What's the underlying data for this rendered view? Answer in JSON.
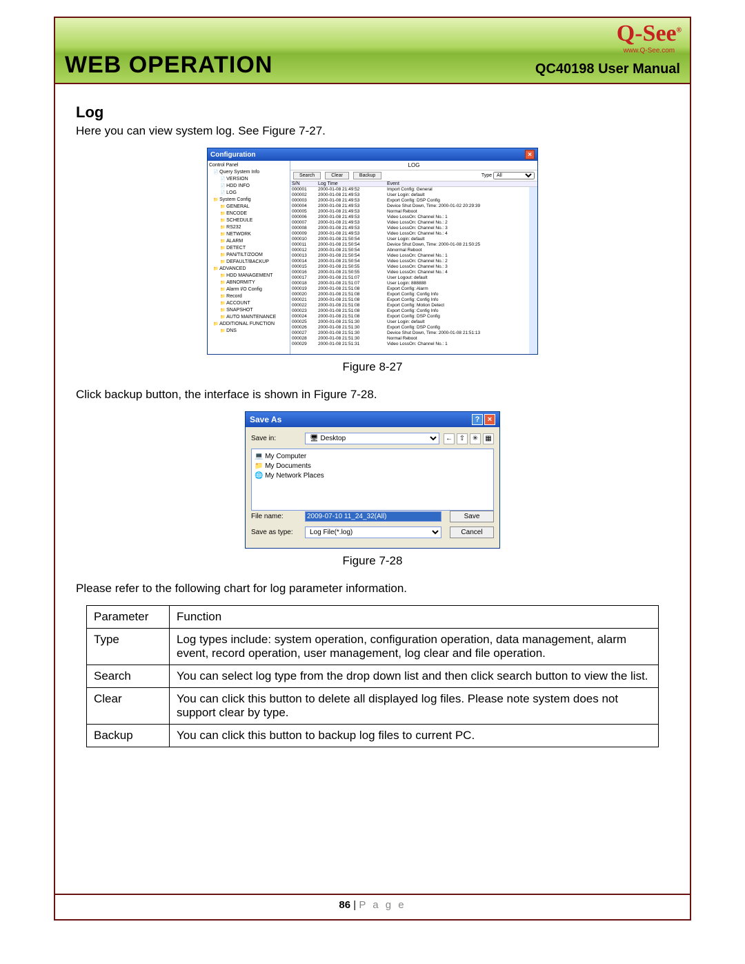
{
  "header": {
    "title": "WEB OPERATION",
    "subtitle": "QC40198 User Manual",
    "logo_text": "Q-See",
    "logo_sub": "www.Q-See.com"
  },
  "section_heading": "Log",
  "intro_text": "Here you can view system log. See Figure 7-27.",
  "fig27": {
    "window_title": "Configuration",
    "tree_header": "Control Panel",
    "tree": [
      {
        "l": 1,
        "t": "Query System Info",
        "c": "file"
      },
      {
        "l": 2,
        "t": "VERSION",
        "c": "file"
      },
      {
        "l": 2,
        "t": "HDD INFO",
        "c": "file"
      },
      {
        "l": 2,
        "t": "LOG",
        "c": "file"
      },
      {
        "l": 1,
        "t": "System Config",
        "c": "folder"
      },
      {
        "l": 2,
        "t": "GENERAL",
        "c": "folder"
      },
      {
        "l": 2,
        "t": "ENCODE",
        "c": "folder"
      },
      {
        "l": 2,
        "t": "SCHEDULE",
        "c": "folder"
      },
      {
        "l": 2,
        "t": "RS232",
        "c": "folder"
      },
      {
        "l": 2,
        "t": "NETWORK",
        "c": "folder"
      },
      {
        "l": 2,
        "t": "ALARM",
        "c": "folder"
      },
      {
        "l": 2,
        "t": "DETECT",
        "c": "folder"
      },
      {
        "l": 2,
        "t": "PAN/TILT/ZOOM",
        "c": "folder"
      },
      {
        "l": 2,
        "t": "DEFAULT/BACKUP",
        "c": "folder"
      },
      {
        "l": 1,
        "t": "ADVANCED",
        "c": "folder"
      },
      {
        "l": 2,
        "t": "HDD MANAGEMENT",
        "c": "folder"
      },
      {
        "l": 2,
        "t": "ABNORMITY",
        "c": "folder"
      },
      {
        "l": 2,
        "t": "Alarm I/O Config",
        "c": "folder"
      },
      {
        "l": 2,
        "t": "Record",
        "c": "folder"
      },
      {
        "l": 2,
        "t": "ACCOUNT",
        "c": "folder"
      },
      {
        "l": 2,
        "t": "SNAPSHOT",
        "c": "folder"
      },
      {
        "l": 2,
        "t": "AUTO MAINTENANCE",
        "c": "folder"
      },
      {
        "l": 1,
        "t": "ADDITIONAL FUNCTION",
        "c": "folder"
      },
      {
        "l": 2,
        "t": "DNS",
        "c": "folder"
      }
    ],
    "panel_label": "LOG",
    "btn_search": "Search",
    "btn_clear": "Clear",
    "btn_backup": "Backup",
    "type_label": "Type",
    "type_value": "All",
    "col_sn": "S/N",
    "col_time": "Log Time",
    "col_event": "Event",
    "rows": [
      {
        "sn": "000001",
        "t": "2000-01-08 21:49:52",
        "e": "Import Config: General"
      },
      {
        "sn": "000002",
        "t": "2000-01-08 21:49:53",
        "e": "User Login: default"
      },
      {
        "sn": "000003",
        "t": "2000-01-08 21:49:53",
        "e": "Export Config: DSP Config"
      },
      {
        "sn": "000004",
        "t": "2000-01-08 21:49:53",
        "e": "Device Shut Down, Time: 2000-01-02 20:29:39"
      },
      {
        "sn": "000005",
        "t": "2000-01-08 21:49:53",
        "e": "Normal Reboot"
      },
      {
        "sn": "000006",
        "t": "2000-01-08 21:49:53",
        "e": "Video LossOn: Channel No.: 1"
      },
      {
        "sn": "000007",
        "t": "2000-01-08 21:49:53",
        "e": "Video LossOn: Channel No.: 2"
      },
      {
        "sn": "000008",
        "t": "2000-01-08 21:49:53",
        "e": "Video LossOn: Channel No.: 3"
      },
      {
        "sn": "000009",
        "t": "2000-01-08 21:49:53",
        "e": "Video LossOn: Channel No.: 4"
      },
      {
        "sn": "000010",
        "t": "2000-01-08 21:50:54",
        "e": "User Login: default"
      },
      {
        "sn": "000011",
        "t": "2000-01-08 21:50:54",
        "e": "Device Shut Down, Time: 2000-01-08 21:50:25"
      },
      {
        "sn": "000012",
        "t": "2000-01-08 21:50:54",
        "e": "Abnormal Reboot"
      },
      {
        "sn": "000013",
        "t": "2000-01-08 21:50:54",
        "e": "Video LossOn: Channel No.: 1"
      },
      {
        "sn": "000014",
        "t": "2000-01-08 21:50:54",
        "e": "Video LossOn: Channel No.: 2"
      },
      {
        "sn": "000015",
        "t": "2000-01-08 21:50:55",
        "e": "Video LossOn: Channel No.: 3"
      },
      {
        "sn": "000016",
        "t": "2000-01-08 21:50:55",
        "e": "Video LossOn: Channel No.: 4"
      },
      {
        "sn": "000017",
        "t": "2000-01-08 21:51:07",
        "e": "User Logout: default"
      },
      {
        "sn": "000018",
        "t": "2000-01-08 21:51:07",
        "e": "User Login: 888888"
      },
      {
        "sn": "000019",
        "t": "2000-01-08 21:51:08",
        "e": "Export Config: Alarm"
      },
      {
        "sn": "000020",
        "t": "2000-01-08 21:51:08",
        "e": "Export Config: Config Info"
      },
      {
        "sn": "000021",
        "t": "2000-01-08 21:51:08",
        "e": "Export Config: Config Info"
      },
      {
        "sn": "000022",
        "t": "2000-01-08 21:51:08",
        "e": "Export Config: Motion Detect"
      },
      {
        "sn": "000023",
        "t": "2000-01-08 21:51:08",
        "e": "Export Config: Config Info"
      },
      {
        "sn": "000024",
        "t": "2000-01-08 21:51:08",
        "e": "Export Config: DSP Config"
      },
      {
        "sn": "000025",
        "t": "2000-01-08 21:51:30",
        "e": "User Login: default"
      },
      {
        "sn": "000026",
        "t": "2000-01-08 21:51:30",
        "e": "Export Config: DSP Config"
      },
      {
        "sn": "000027",
        "t": "2000-01-08 21:51:30",
        "e": "Device Shut Down, Time: 2000-01-08 21:51:13"
      },
      {
        "sn": "000028",
        "t": "2000-01-08 21:51:30",
        "e": "Normal Reboot"
      },
      {
        "sn": "000029",
        "t": "2000-01-08 21:51:31",
        "e": "Video LossOn: Channel No.: 1"
      }
    ]
  },
  "caption_27": "Figure 8-27",
  "mid_text": "Click backup button, the interface is shown in Figure 7-28.",
  "fig28": {
    "title": "Save As",
    "savein_label": "Save in:",
    "savein_value": "Desktop",
    "list": [
      "My Computer",
      "My Documents",
      "My Network Places"
    ],
    "filename_label": "File name:",
    "filename_value": "2009-07-10 11_24_32(All)",
    "type_label": "Save as type:",
    "type_value": "Log File(*.log)",
    "btn_save": "Save",
    "btn_cancel": "Cancel"
  },
  "caption_28": "Figure 7-28",
  "chart_intro": "Please refer to the following chart for log parameter information.",
  "table": {
    "h1": "Parameter",
    "h2": "Function",
    "rows": [
      {
        "p": "Type",
        "f": "Log types include: system operation, configuration operation, data management, alarm event, record operation, user management, log clear and file operation."
      },
      {
        "p": "Search",
        "f": "You can select log type from the drop down list and then click search button to view the list."
      },
      {
        "p": "Clear",
        "f": "You can click this button to delete all displayed log files.  Please note system does not support clear by type."
      },
      {
        "p": "Backup",
        "f": "You can click this button to backup log files to current PC."
      }
    ]
  },
  "footer": {
    "num": "86",
    "sep": " | ",
    "word": "P a g e"
  }
}
